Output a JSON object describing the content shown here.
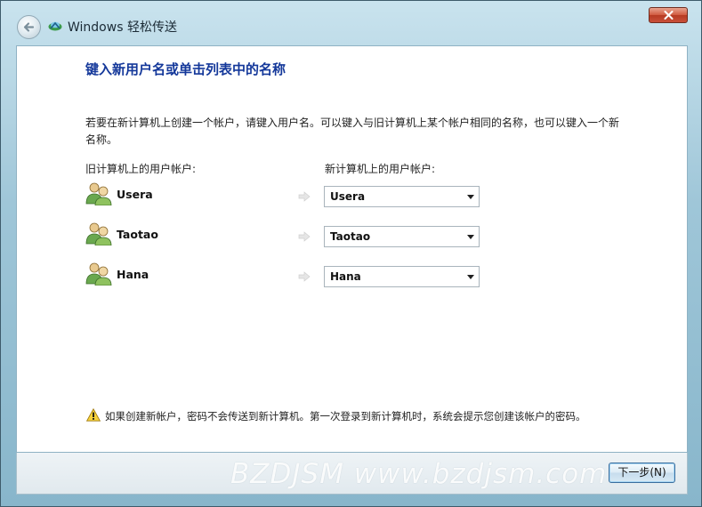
{
  "window": {
    "title": "Windows 轻松传送",
    "back_icon": "back-arrow-icon",
    "app_icon": "easy-transfer-icon",
    "close_icon": "close-icon"
  },
  "page": {
    "heading": "键入新用户名或单击列表中的名称",
    "description": "若要在新计算机上创建一个帐户，请键入用户名。可以键入与旧计算机上某个帐户相同的名称，也可以键入一个新名称。",
    "old_column_label": "旧计算机上的用户帐户:",
    "new_column_label": "新计算机上的用户帐户:"
  },
  "users": [
    {
      "old_name": "Usera",
      "new_name": "Usera"
    },
    {
      "old_name": "Taotao",
      "new_name": "Taotao"
    },
    {
      "old_name": "Hana",
      "new_name": "Hana"
    }
  ],
  "warning": {
    "icon": "warning-icon",
    "text": "如果创建新帐户，密码不会传送到新计算机。第一次登录到新计算机时，系统会提示您创建该帐户的密码。"
  },
  "footer": {
    "next_label": "下一步(N)",
    "watermark": "BZDJSM www.bzdjsm.com"
  },
  "colors": {
    "heading": "#14389a",
    "frame": "#9fc6d8",
    "close": "#c9503a"
  }
}
